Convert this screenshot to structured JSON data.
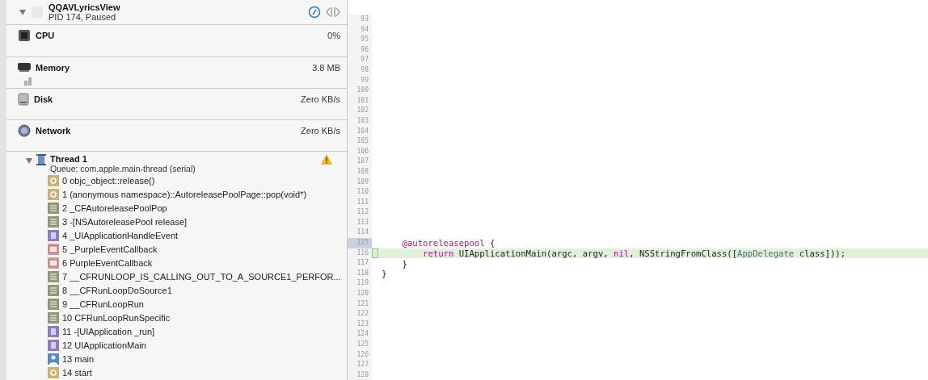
{
  "process": {
    "name": "QQAVLyricsView",
    "status": "PID 174, Paused",
    "expanded": true
  },
  "gauges": [
    {
      "kind": "cpu",
      "label": "CPU",
      "value": "0%"
    },
    {
      "kind": "memory",
      "label": "Memory",
      "value": "3.8 MB"
    },
    {
      "kind": "disk",
      "label": "Disk",
      "value": "Zero KB/s"
    },
    {
      "kind": "network",
      "label": "Network",
      "value": "Zero KB/s"
    }
  ],
  "thread": {
    "name": "Thread 1",
    "queue": "Queue: com.apple.main-thread (serial)",
    "expanded": true,
    "warning": true,
    "frames": [
      {
        "kind": "gear",
        "label": "0 objc_object::release()"
      },
      {
        "kind": "gear",
        "label": "1 (anonymous namespace)::AutoreleasePoolPage::pop(void*)"
      },
      {
        "kind": "library",
        "label": "2 _CFAutoreleasePoolPop"
      },
      {
        "kind": "library",
        "label": "3 -[NSAutoreleasePool release]"
      },
      {
        "kind": "uikit",
        "label": "4 _UIApplicationHandleEvent"
      },
      {
        "kind": "framework",
        "label": "5 _PurpleEventCallback"
      },
      {
        "kind": "framework",
        "label": "6 PurpleEventCallback"
      },
      {
        "kind": "library",
        "label": "7 __CFRUNLOOP_IS_CALLING_OUT_TO_A_SOURCE1_PERFOR..."
      },
      {
        "kind": "library",
        "label": "8 __CFRunLoopDoSource1"
      },
      {
        "kind": "library",
        "label": "9 __CFRunLoopRun"
      },
      {
        "kind": "library",
        "label": "10 CFRunLoopRunSpecific"
      },
      {
        "kind": "uikit",
        "label": "11 -[UIApplication _run]"
      },
      {
        "kind": "uikit",
        "label": "12 UIApplicationMain"
      },
      {
        "kind": "user",
        "label": "13 main"
      },
      {
        "kind": "gear",
        "label": "14 start"
      }
    ]
  },
  "editor": {
    "lines": [
      {
        "number": "93"
      },
      {
        "number": "94"
      },
      {
        "number": "95"
      },
      {
        "number": "96"
      },
      {
        "number": "97"
      },
      {
        "number": "98"
      },
      {
        "number": "99"
      },
      {
        "number": "100"
      },
      {
        "number": "101"
      },
      {
        "number": "102"
      },
      {
        "number": "103"
      },
      {
        "number": "104"
      },
      {
        "number": "105"
      },
      {
        "number": "106"
      },
      {
        "number": "107"
      },
      {
        "number": "108"
      },
      {
        "number": "109"
      },
      {
        "number": "110"
      },
      {
        "number": "111"
      },
      {
        "number": "112"
      },
      {
        "number": "113"
      },
      {
        "number": "114"
      },
      {
        "number": "115",
        "selected": true,
        "tokens": [
          {
            "kind": "keyword",
            "text": "    @autoreleasepool"
          },
          {
            "kind": "plain",
            "text": " {"
          }
        ]
      },
      {
        "number": "116",
        "current": true,
        "tokens": [
          {
            "kind": "keyword",
            "text": "        return"
          },
          {
            "kind": "plain",
            "text": " UIApplicationMain(argc, argv, "
          },
          {
            "kind": "keyword",
            "text": "nil"
          },
          {
            "kind": "plain",
            "text": ", NSStringFromClass(["
          },
          {
            "kind": "class",
            "text": "AppDelegate"
          },
          {
            "kind": "plain",
            "text": " class]));"
          }
        ]
      },
      {
        "number": "117",
        "tokens": [
          {
            "kind": "plain",
            "text": "    }"
          }
        ]
      },
      {
        "number": "118",
        "tokens": [
          {
            "kind": "plain",
            "text": "}"
          }
        ]
      },
      {
        "number": "119"
      },
      {
        "number": "120"
      },
      {
        "number": "121"
      },
      {
        "number": "122"
      },
      {
        "number": "123"
      },
      {
        "number": "124"
      },
      {
        "number": "125"
      },
      {
        "number": "126"
      },
      {
        "number": "127"
      },
      {
        "number": "128"
      }
    ]
  }
}
